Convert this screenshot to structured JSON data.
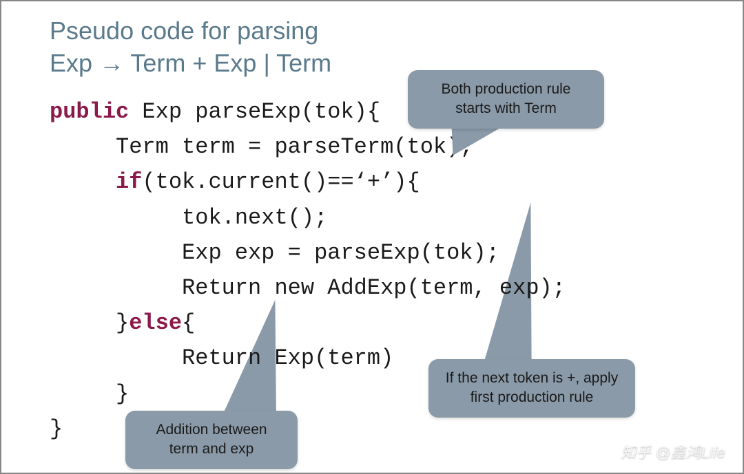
{
  "heading": {
    "line1": "Pseudo code for parsing",
    "line2": "Exp → Term + Exp | Term"
  },
  "code": {
    "kw_public": "public",
    "l1_rest": " Exp parseExp(tok){",
    "l2": "     Term term = parseTerm(tok);",
    "kw_if": "if",
    "l3_rest": "(tok.current()==‘+’){",
    "l4": "          tok.next();",
    "l5": "          Exp exp = parseExp(tok);",
    "l6": "          Return new AddExp(term, exp);",
    "l7_pre": "     }",
    "kw_else": "else",
    "l7_post": "{",
    "l8": "          Return Exp(term)",
    "l9": "     }",
    "l10": "}"
  },
  "callouts": {
    "c1": "Both production rule starts with Term",
    "c2": "If the next token is +, apply first production rule",
    "c3": "Addition between term and exp"
  },
  "watermark": "知乎 @鑫鸿Life"
}
